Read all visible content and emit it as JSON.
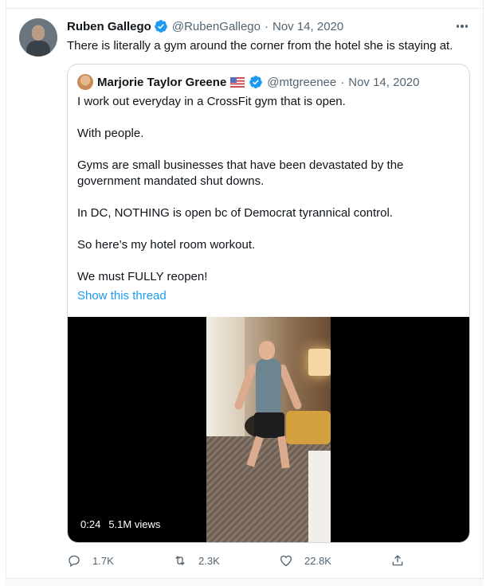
{
  "tweet": {
    "author_name": "Ruben Gallego",
    "handle": "@RubenGallego",
    "separator": "·",
    "date": "Nov 14, 2020",
    "text": "There is literally a gym around the corner from the hotel she is staying at."
  },
  "quoted": {
    "author_name": "Marjorie Taylor Greene",
    "handle": "@mtgreenee",
    "separator": "·",
    "date": "Nov 14, 2020",
    "paragraphs": [
      "I work out everyday in a CrossFit gym that is open.",
      "With people.",
      "Gyms are small businesses that have been devastated by the government mandated shut downs.",
      "In DC, NOTHING is open bc of Democrat tyrannical control.",
      "So here’s my hotel room workout.",
      "We must FULLY reopen!"
    ],
    "show_thread_label": "Show this thread",
    "video": {
      "duration": "0:24",
      "views": "5.1M views"
    }
  },
  "actions": {
    "replies": "1.7K",
    "retweets": "2.3K",
    "likes": "22.8K"
  },
  "icons": {
    "verified": "verified-badge-icon",
    "flag": "us-flag-icon",
    "more": "more-options-icon",
    "reply": "reply-icon",
    "retweet": "retweet-icon",
    "like": "like-heart-icon",
    "share": "share-icon"
  },
  "colors": {
    "accent": "#1d9bf0",
    "text": "#0f1419",
    "muted": "#536471",
    "border": "#cfd9de"
  }
}
